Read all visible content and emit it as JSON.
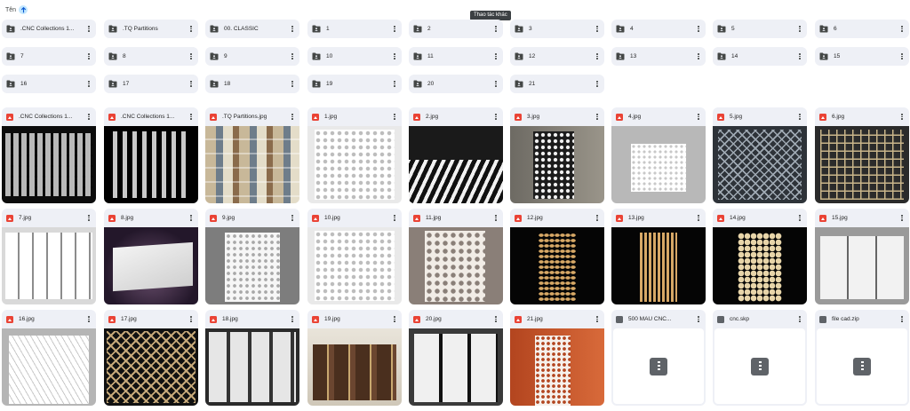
{
  "header": {
    "sort_label": "Tên",
    "sort_icon": "arrow-up-icon",
    "tooltip": "Thao tác khác"
  },
  "colors": {
    "card_bg": "#eef0f6",
    "image_icon": "#ea4335",
    "sort_chip": "#c2e7ff",
    "tooltip_bg": "#3c4043"
  },
  "folders": [
    ".CNC Collections 1...",
    ".TQ Partitions",
    "00. CLASSIC",
    "1",
    "2",
    "3",
    "4",
    "5",
    "6",
    "7",
    "8",
    "9",
    "10",
    "11",
    "12",
    "13",
    "14",
    "15",
    "16",
    "17",
    "18",
    "19",
    "20",
    "21"
  ],
  "files": [
    {
      "name": ".CNC Collections 1...",
      "type": "image"
    },
    {
      "name": ".CNC Collections 1...",
      "type": "image"
    },
    {
      "name": ".TQ Partitions.jpg",
      "type": "image"
    },
    {
      "name": "1.jpg",
      "type": "image"
    },
    {
      "name": "2.jpg",
      "type": "image"
    },
    {
      "name": "3.jpg",
      "type": "image"
    },
    {
      "name": "4.jpg",
      "type": "image"
    },
    {
      "name": "5.jpg",
      "type": "image"
    },
    {
      "name": "6.jpg",
      "type": "image"
    },
    {
      "name": "7.jpg",
      "type": "image"
    },
    {
      "name": "8.jpg",
      "type": "image"
    },
    {
      "name": "9.jpg",
      "type": "image"
    },
    {
      "name": "10.jpg",
      "type": "image"
    },
    {
      "name": "11.jpg",
      "type": "image"
    },
    {
      "name": "12.jpg",
      "type": "image"
    },
    {
      "name": "13.jpg",
      "type": "image"
    },
    {
      "name": "14.jpg",
      "type": "image"
    },
    {
      "name": "15.jpg",
      "type": "image"
    },
    {
      "name": "16.jpg",
      "type": "image"
    },
    {
      "name": "17.jpg",
      "type": "image"
    },
    {
      "name": "18.jpg",
      "type": "image"
    },
    {
      "name": "19.jpg",
      "type": "image"
    },
    {
      "name": "20.jpg",
      "type": "image"
    },
    {
      "name": "21.jpg",
      "type": "image"
    },
    {
      "name": "500 MAU CNC...",
      "type": "file"
    },
    {
      "name": "cnc.skp",
      "type": "file"
    },
    {
      "name": "file cad.zip",
      "type": "file"
    }
  ]
}
